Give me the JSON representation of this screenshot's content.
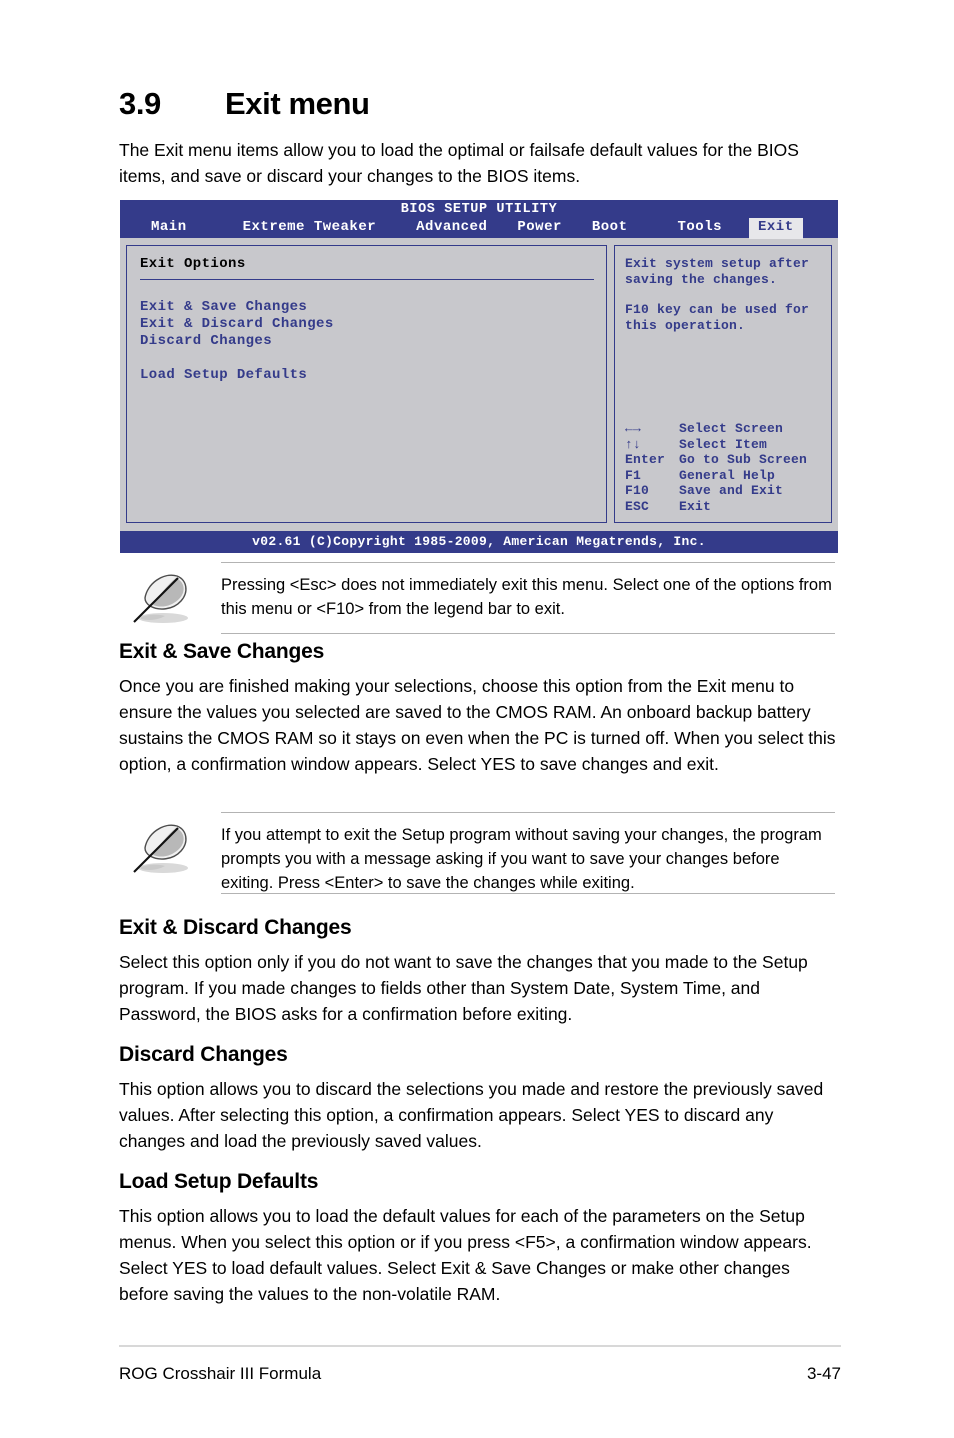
{
  "section": {
    "number": "3.9",
    "title": "Exit menu",
    "intro": "The Exit menu items allow you to load the optimal or failsafe default values for the BIOS items, and save or discard your changes to the BIOS items."
  },
  "bios": {
    "title": "BIOS SETUP UTILITY",
    "tabs": [
      {
        "label": "Main",
        "active": false
      },
      {
        "label": "Extreme Tweaker",
        "active": false
      },
      {
        "label": "Advanced",
        "active": false
      },
      {
        "label": "Power",
        "active": false
      },
      {
        "label": "Boot",
        "active": false
      },
      {
        "label": "Tools",
        "active": false
      },
      {
        "label": "Exit",
        "active": true
      }
    ],
    "panel_title": "Exit Options",
    "options": [
      "Exit & Save Changes",
      "Exit & Discard Changes",
      "Discard Changes"
    ],
    "options_second_group": [
      "Load Setup Defaults"
    ],
    "help": {
      "line1": "Exit system setup after",
      "line2": "saving the changes.",
      "line3": "F10 key can be used for",
      "line4": "this operation."
    },
    "legend": [
      {
        "key": "←→",
        "desc": "Select Screen"
      },
      {
        "key": "↑↓",
        "desc": "Select Item"
      },
      {
        "key": "Enter",
        "desc": "Go to Sub Screen"
      },
      {
        "key": "F1",
        "desc": "General Help"
      },
      {
        "key": "F10",
        "desc": "Save and Exit"
      },
      {
        "key": "ESC",
        "desc": "Exit"
      }
    ],
    "footer": "v02.61 (C)Copyright 1985-2009, American Megatrends, Inc.",
    "colors": {
      "chrome_blue": "#343b8a",
      "panel_gray": "#c8c8cc",
      "active_tab_bg": "#e7e7ea"
    }
  },
  "notes": [
    {
      "icon": "quill-pen-icon",
      "text": "Pressing <Esc> does not immediately exit this menu. Select one of the options from this menu or <F10> from the legend bar to exit."
    },
    {
      "icon": "quill-pen-icon",
      "text": " If you attempt to exit the Setup program without saving your changes, the program prompts you with a message asking if you want to save your changes before exiting. Press <Enter>  to save the changes while exiting."
    }
  ],
  "subsections": [
    {
      "heading": "Exit & Save Changes",
      "body": "Once you are finished making your selections, choose this option from the Exit menu to ensure the values you selected are saved to the CMOS RAM. An onboard backup battery sustains the CMOS RAM so it stays on even when the PC is turned off. When you select this option, a confirmation window appears. Select YES to save changes and exit."
    },
    {
      "heading": "Exit & Discard Changes",
      "body": "Select this option only if you do not want to save the changes that you  made to the Setup program. If you made changes to fields other than System Date, System Time, and Password, the BIOS asks for a confirmation before exiting."
    },
    {
      "heading": "Discard Changes",
      "body": "This option allows you to discard the selections you made and restore the previously saved values. After selecting this option, a confirmation appears. Select YES to discard any changes and load the previously saved values."
    },
    {
      "heading": "Load Setup Defaults",
      "body": "This option allows you to load the default values for each of the parameters on the Setup menus. When you select this option or if you press <F5>, a confirmation window appears. Select YES to load default values. Select Exit & Save Changes or make other changes before saving the values to the non-volatile RAM."
    }
  ],
  "page_footer": {
    "product": "ROG Crosshair III Formula",
    "page_number": "3-47"
  }
}
